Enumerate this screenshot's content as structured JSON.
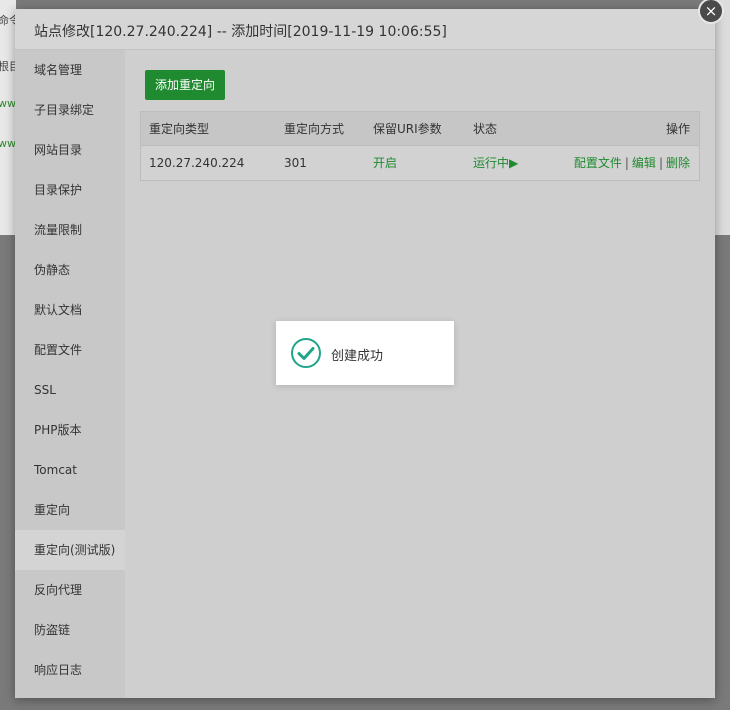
{
  "background": {
    "strip_cells": [
      "命令",
      "根目",
      "www",
      "www"
    ]
  },
  "modal": {
    "title": "站点修改[120.27.240.224] -- 添加时间[2019-11-19 10:06:55]",
    "close_label": "×"
  },
  "sidebar": {
    "items": [
      {
        "label": "域名管理"
      },
      {
        "label": "子目录绑定"
      },
      {
        "label": "网站目录"
      },
      {
        "label": "目录保护"
      },
      {
        "label": "流量限制"
      },
      {
        "label": "伪静态"
      },
      {
        "label": "默认文档"
      },
      {
        "label": "配置文件"
      },
      {
        "label": "SSL"
      },
      {
        "label": "PHP版本"
      },
      {
        "label": "Tomcat"
      },
      {
        "label": "重定向"
      },
      {
        "label": "重定向(测试版)",
        "active": true
      },
      {
        "label": "反向代理"
      },
      {
        "label": "防盗链"
      },
      {
        "label": "响应日志"
      }
    ]
  },
  "content": {
    "add_button": "添加重定向",
    "table": {
      "headers": [
        "重定向类型",
        "重定向方式",
        "保留URI参数",
        "状态",
        "操作"
      ],
      "rows": [
        {
          "type": "120.27.240.224",
          "method": "301",
          "keep_uri": "开启",
          "status": "运行中▶",
          "ops": [
            "配置文件",
            "编辑",
            "删除"
          ],
          "sep": "|"
        }
      ]
    }
  },
  "toast": {
    "message": "创建成功",
    "icon": "check-circle-icon"
  },
  "colors": {
    "accent_green": "#1f8a2f",
    "success_teal": "#20a58a"
  }
}
